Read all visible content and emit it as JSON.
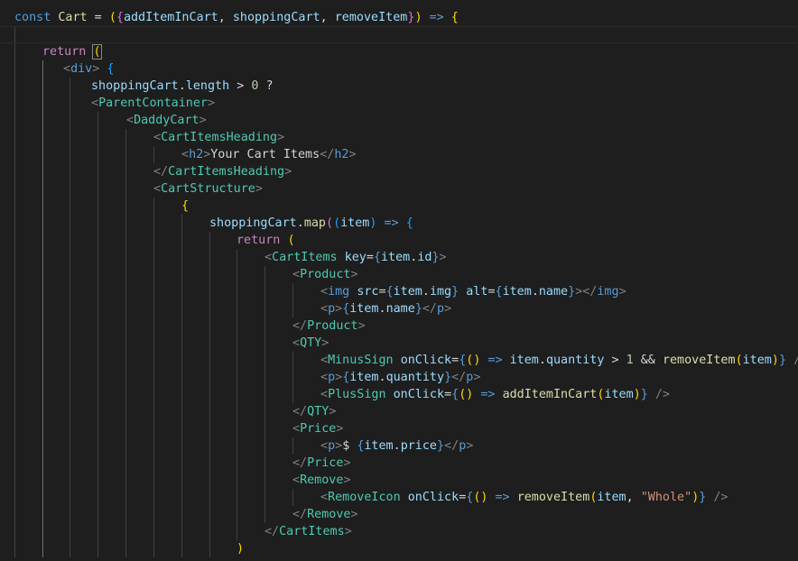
{
  "colors": {
    "background": "#1e1e1e",
    "keyword": "#569cd6",
    "control": "#c586c0",
    "variable": "#9cdcfe",
    "function": "#dcdcaa",
    "component": "#4ec9b0",
    "bracket_gold": "#ffd700",
    "bracket_orchid": "#da70d6",
    "bracket_blue": "#179fff",
    "number": "#b5cea8",
    "string": "#ce9178",
    "punctuation": "#808080"
  },
  "code": {
    "lines": [
      {
        "segs": [
          [
            "kw",
            "const "
          ],
          [
            "fn",
            "Cart"
          ],
          [
            "op",
            " = "
          ],
          [
            "p1",
            "("
          ],
          [
            "p2",
            "{"
          ],
          [
            "var",
            "addItemInCart"
          ],
          [
            "op",
            ", "
          ],
          [
            "var",
            "shoppingCart"
          ],
          [
            "op",
            ", "
          ],
          [
            "var",
            "removeItem"
          ],
          [
            "p2",
            "}"
          ],
          [
            "p1",
            ")"
          ],
          [
            "kw",
            " => "
          ],
          [
            "p1",
            "{"
          ]
        ]
      },
      {
        "segs": []
      },
      {
        "segs": [
          [
            "ctl",
            "return "
          ],
          [
            "p2m",
            "("
          ]
        ]
      },
      {
        "segs": [
          [
            "br",
            "<"
          ],
          [
            "html",
            "div"
          ],
          [
            "br",
            ">"
          ],
          [
            "op",
            " "
          ],
          [
            "p3",
            "{"
          ]
        ]
      },
      {
        "segs": [
          [
            "var",
            "shoppingCart"
          ],
          [
            "op",
            "."
          ],
          [
            "var",
            "length"
          ],
          [
            "op",
            " > "
          ],
          [
            "num",
            "0"
          ],
          [
            "op",
            " ?"
          ]
        ]
      },
      {
        "segs": [
          [
            "br",
            "<"
          ],
          [
            "tag",
            "ParentContainer"
          ],
          [
            "br",
            ">"
          ]
        ]
      },
      {
        "segs": [
          [
            "br",
            "<"
          ],
          [
            "tag",
            "DaddyCart"
          ],
          [
            "br",
            ">"
          ]
        ]
      },
      {
        "segs": [
          [
            "br",
            "<"
          ],
          [
            "tag",
            "CartItemsHeading"
          ],
          [
            "br",
            ">"
          ]
        ]
      },
      {
        "segs": [
          [
            "br",
            "<"
          ],
          [
            "html",
            "h2"
          ],
          [
            "br",
            ">"
          ],
          [
            "txt",
            "Your Cart Items"
          ],
          [
            "br",
            "</"
          ],
          [
            "html",
            "h2"
          ],
          [
            "br",
            ">"
          ]
        ]
      },
      {
        "segs": [
          [
            "br",
            "</"
          ],
          [
            "tag",
            "CartItemsHeading"
          ],
          [
            "br",
            ">"
          ]
        ]
      },
      {
        "segs": [
          [
            "br",
            "<"
          ],
          [
            "tag",
            "CartStructure"
          ],
          [
            "br",
            ">"
          ]
        ]
      },
      {
        "segs": [
          [
            "p1",
            "{"
          ]
        ]
      },
      {
        "segs": [
          [
            "var",
            "shoppingCart"
          ],
          [
            "op",
            "."
          ],
          [
            "fn",
            "map"
          ],
          [
            "p2",
            "("
          ],
          [
            "p3",
            "("
          ],
          [
            "var",
            "item"
          ],
          [
            "p3",
            ")"
          ],
          [
            "kw",
            " => "
          ],
          [
            "p3",
            "{"
          ]
        ]
      },
      {
        "segs": [
          [
            "ctl",
            "return "
          ],
          [
            "p1",
            "("
          ]
        ]
      },
      {
        "segs": [
          [
            "br",
            "<"
          ],
          [
            "tag",
            "CartItems"
          ],
          [
            "op",
            " "
          ],
          [
            "var",
            "key"
          ],
          [
            "op",
            "="
          ],
          [
            "kw",
            "{"
          ],
          [
            "var",
            "item"
          ],
          [
            "op",
            "."
          ],
          [
            "var",
            "id"
          ],
          [
            "kw",
            "}"
          ],
          [
            "br",
            ">"
          ]
        ]
      },
      {
        "segs": [
          [
            "br",
            "<"
          ],
          [
            "tag",
            "Product"
          ],
          [
            "br",
            ">"
          ]
        ]
      },
      {
        "segs": [
          [
            "br",
            "<"
          ],
          [
            "html",
            "img"
          ],
          [
            "op",
            " "
          ],
          [
            "var",
            "src"
          ],
          [
            "op",
            "="
          ],
          [
            "kw",
            "{"
          ],
          [
            "var",
            "item"
          ],
          [
            "op",
            "."
          ],
          [
            "var",
            "img"
          ],
          [
            "kw",
            "}"
          ],
          [
            "op",
            " "
          ],
          [
            "var",
            "alt"
          ],
          [
            "op",
            "="
          ],
          [
            "kw",
            "{"
          ],
          [
            "var",
            "item"
          ],
          [
            "op",
            "."
          ],
          [
            "var",
            "name"
          ],
          [
            "kw",
            "}"
          ],
          [
            "br",
            "></"
          ],
          [
            "html",
            "img"
          ],
          [
            "br",
            ">"
          ]
        ]
      },
      {
        "segs": [
          [
            "br",
            "<"
          ],
          [
            "html",
            "p"
          ],
          [
            "br",
            ">"
          ],
          [
            "kw",
            "{"
          ],
          [
            "var",
            "item"
          ],
          [
            "op",
            "."
          ],
          [
            "var",
            "name"
          ],
          [
            "kw",
            "}"
          ],
          [
            "br",
            "</"
          ],
          [
            "html",
            "p"
          ],
          [
            "br",
            ">"
          ]
        ]
      },
      {
        "segs": [
          [
            "br",
            "</"
          ],
          [
            "tag",
            "Product"
          ],
          [
            "br",
            ">"
          ]
        ]
      },
      {
        "segs": [
          [
            "br",
            "<"
          ],
          [
            "tag",
            "QTY"
          ],
          [
            "br",
            ">"
          ]
        ]
      },
      {
        "segs": [
          [
            "br",
            "<"
          ],
          [
            "tag",
            "MinusSign"
          ],
          [
            "op",
            " "
          ],
          [
            "var",
            "onClick"
          ],
          [
            "op",
            "="
          ],
          [
            "kw",
            "{"
          ],
          [
            "p1",
            "("
          ],
          [
            "p1",
            ")"
          ],
          [
            "kw",
            " => "
          ],
          [
            "var",
            "item"
          ],
          [
            "op",
            "."
          ],
          [
            "var",
            "quantity"
          ],
          [
            "op",
            " > "
          ],
          [
            "num",
            "1"
          ],
          [
            "op",
            " && "
          ],
          [
            "fn",
            "removeItem"
          ],
          [
            "p1",
            "("
          ],
          [
            "var",
            "item"
          ],
          [
            "p1",
            ")"
          ],
          [
            "kw",
            "}"
          ],
          [
            "op",
            " "
          ],
          [
            "br",
            "/>"
          ]
        ]
      },
      {
        "segs": [
          [
            "br",
            "<"
          ],
          [
            "html",
            "p"
          ],
          [
            "br",
            ">"
          ],
          [
            "kw",
            "{"
          ],
          [
            "var",
            "item"
          ],
          [
            "op",
            "."
          ],
          [
            "var",
            "quantity"
          ],
          [
            "kw",
            "}"
          ],
          [
            "br",
            "</"
          ],
          [
            "html",
            "p"
          ],
          [
            "br",
            ">"
          ]
        ]
      },
      {
        "segs": [
          [
            "br",
            "<"
          ],
          [
            "tag",
            "PlusSign"
          ],
          [
            "op",
            " "
          ],
          [
            "var",
            "onClick"
          ],
          [
            "op",
            "="
          ],
          [
            "kw",
            "{"
          ],
          [
            "p1",
            "("
          ],
          [
            "p1",
            ")"
          ],
          [
            "kw",
            " => "
          ],
          [
            "fn",
            "addItemInCart"
          ],
          [
            "p1",
            "("
          ],
          [
            "var",
            "item"
          ],
          [
            "p1",
            ")"
          ],
          [
            "kw",
            "}"
          ],
          [
            "op",
            " "
          ],
          [
            "br",
            "/>"
          ]
        ]
      },
      {
        "segs": [
          [
            "br",
            "</"
          ],
          [
            "tag",
            "QTY"
          ],
          [
            "br",
            ">"
          ]
        ]
      },
      {
        "segs": [
          [
            "br",
            "<"
          ],
          [
            "tag",
            "Price"
          ],
          [
            "br",
            ">"
          ]
        ]
      },
      {
        "segs": [
          [
            "br",
            "<"
          ],
          [
            "html",
            "p"
          ],
          [
            "br",
            ">"
          ],
          [
            "txt",
            "$ "
          ],
          [
            "kw",
            "{"
          ],
          [
            "var",
            "item"
          ],
          [
            "op",
            "."
          ],
          [
            "var",
            "price"
          ],
          [
            "kw",
            "}"
          ],
          [
            "br",
            "</"
          ],
          [
            "html",
            "p"
          ],
          [
            "br",
            ">"
          ]
        ]
      },
      {
        "segs": [
          [
            "br",
            "</"
          ],
          [
            "tag",
            "Price"
          ],
          [
            "br",
            ">"
          ]
        ]
      },
      {
        "segs": [
          [
            "br",
            "<"
          ],
          [
            "tag",
            "Remove"
          ],
          [
            "br",
            ">"
          ]
        ]
      },
      {
        "segs": [
          [
            "br",
            "<"
          ],
          [
            "tag",
            "RemoveIcon"
          ],
          [
            "op",
            " "
          ],
          [
            "var",
            "onClick"
          ],
          [
            "op",
            "="
          ],
          [
            "kw",
            "{"
          ],
          [
            "p1",
            "("
          ],
          [
            "p1",
            ")"
          ],
          [
            "kw",
            " => "
          ],
          [
            "fn",
            "removeItem"
          ],
          [
            "p1",
            "("
          ],
          [
            "var",
            "item"
          ],
          [
            "op",
            ", "
          ],
          [
            "str",
            "\"Whole\""
          ],
          [
            "p1",
            ")"
          ],
          [
            "kw",
            "}"
          ],
          [
            "op",
            " "
          ],
          [
            "br",
            "/>"
          ]
        ]
      },
      {
        "segs": [
          [
            "br",
            "</"
          ],
          [
            "tag",
            "Remove"
          ],
          [
            "br",
            ">"
          ]
        ]
      },
      {
        "segs": [
          [
            "br",
            "</"
          ],
          [
            "tag",
            "CartItems"
          ],
          [
            "br",
            ">"
          ]
        ]
      },
      {
        "segs": [
          [
            "p1",
            ")"
          ]
        ]
      }
    ]
  }
}
